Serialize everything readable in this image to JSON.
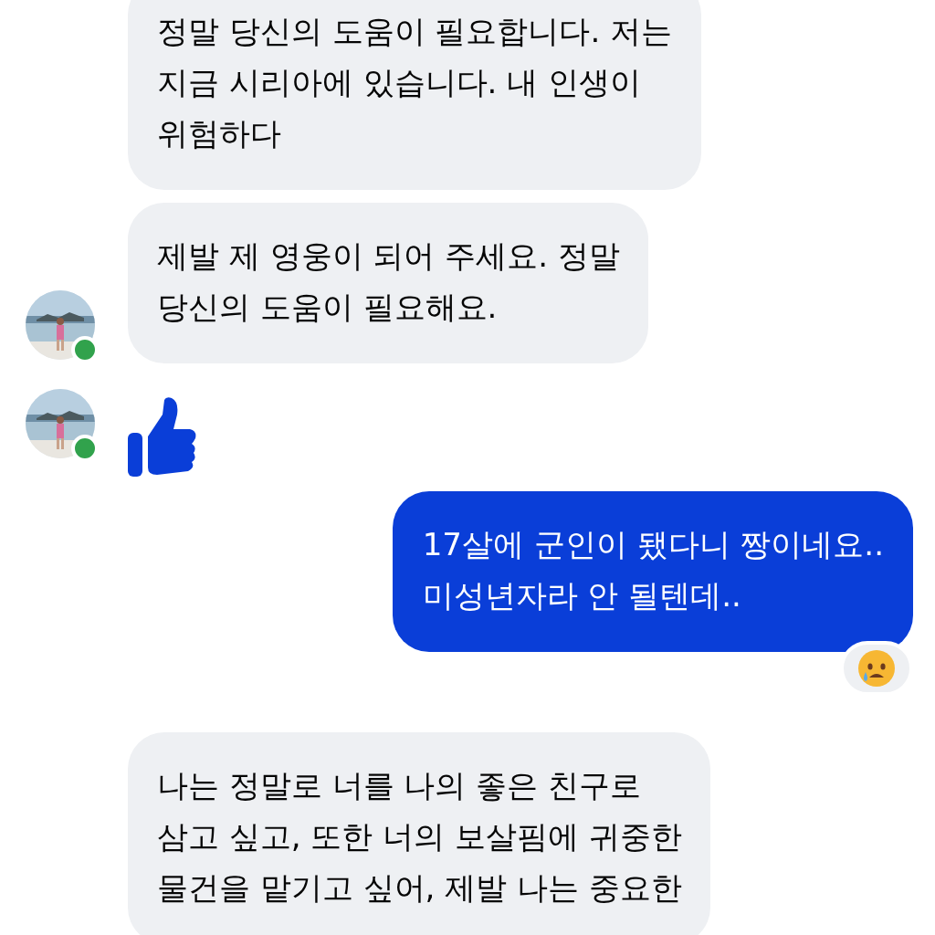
{
  "messages": [
    {
      "kind": "incoming_text",
      "avatar": false,
      "text": "정말 당신의 도움이 필요합니다.  저는\n지금 시리아에 있습니다.  내 인생이\n위험하다"
    },
    {
      "kind": "incoming_text",
      "avatar": true,
      "online": true,
      "text": "제발 제 영웅이 되어 주세요. 정말\n당신의 도움이 필요해요."
    },
    {
      "kind": "incoming_like",
      "avatar": true,
      "online": true
    },
    {
      "kind": "outgoing_text",
      "avatar": false,
      "text": "17살에 군인이 됐다니 짱이네요..\n미성년자라 안 될텐데..",
      "reaction": {
        "kind": "sad"
      }
    },
    {
      "kind": "incoming_text",
      "avatar": false,
      "text": "나는 정말로 너를 나의 좋은 친구로\n삼고 싶고, 또한 너의 보살핌에 귀중한\n물건을 맡기고 싶어, 제발 나는 중요한"
    }
  ]
}
